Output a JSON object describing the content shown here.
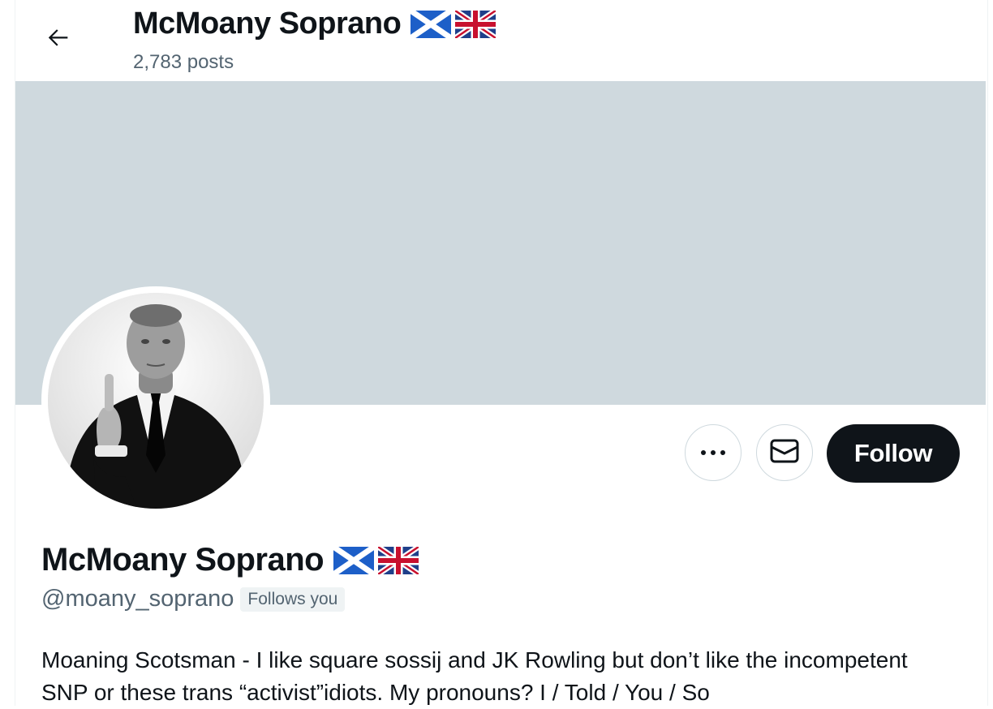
{
  "header": {
    "title": "McMoany Soprano",
    "post_count": "2,783 posts"
  },
  "profile": {
    "display_name": "McMoany Soprano",
    "handle": "@moany_soprano",
    "follows_you_badge": "Follows you",
    "bio": "Moaning Scotsman - I like square sossij and JK Rowling but don’t like the incompetent SNP or these trans “activist”idiots. My pronouns? I / Told / You / So",
    "name_emojis": [
      "scotland-flag-icon",
      "uk-flag-icon"
    ]
  },
  "actions": {
    "follow_label": "Follow",
    "more_icon": "more-dots-icon",
    "message_icon": "envelope-icon"
  },
  "colors": {
    "banner": "#cfd9de",
    "follow_button_bg": "#0f1419",
    "secondary_text": "#536471",
    "border": "#cfd9de"
  }
}
